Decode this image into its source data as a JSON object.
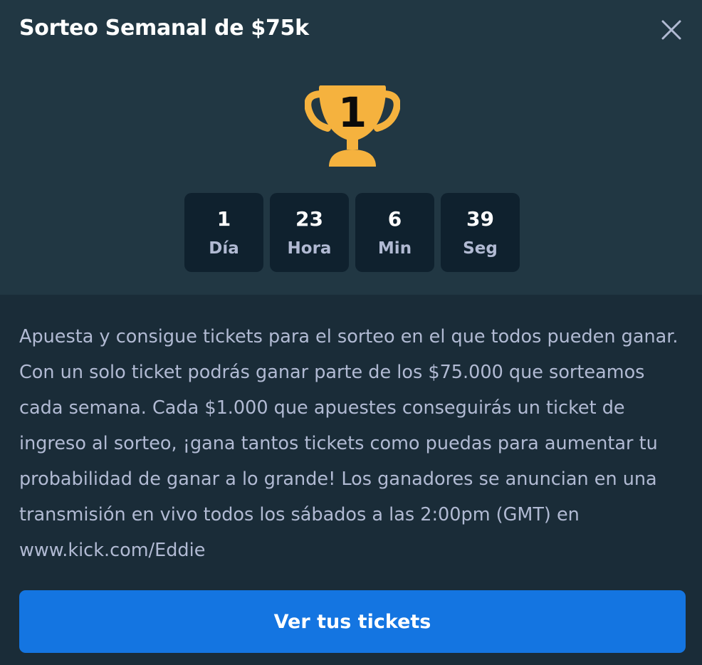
{
  "modal": {
    "title": "Sorteo Semanal de $75k"
  },
  "icons": {
    "close": "close-icon",
    "trophy": "trophy-first-place-icon"
  },
  "trophy": {
    "rank": "1",
    "color": "#f5b23e"
  },
  "countdown": [
    {
      "value": "1",
      "label": "Día"
    },
    {
      "value": "23",
      "label": "Hora"
    },
    {
      "value": "6",
      "label": "Min"
    },
    {
      "value": "39",
      "label": "Seg"
    }
  ],
  "description": "Apuesta y consigue tickets para el sorteo en el que todos pueden ganar. Con un solo ticket podrás ganar parte de los $75.000 que sorteamos cada semana. Cada $1.000 que apuestes conseguirás un ticket de ingreso al sorteo, ¡gana tantos tickets como puedas para aumentar tu probabilidad de ganar a lo grande! Los ganadores se anuncian en una transmisión en vivo todos los sábados a las 2:00pm (GMT) en www.kick.com/Eddie",
  "button": {
    "label": "Ver tus tickets"
  },
  "colors": {
    "header_bg": "#213743",
    "body_bg": "#1a2c38",
    "box_bg": "#0f212e",
    "accent": "#1475e1",
    "muted_text": "#b1bad3"
  }
}
